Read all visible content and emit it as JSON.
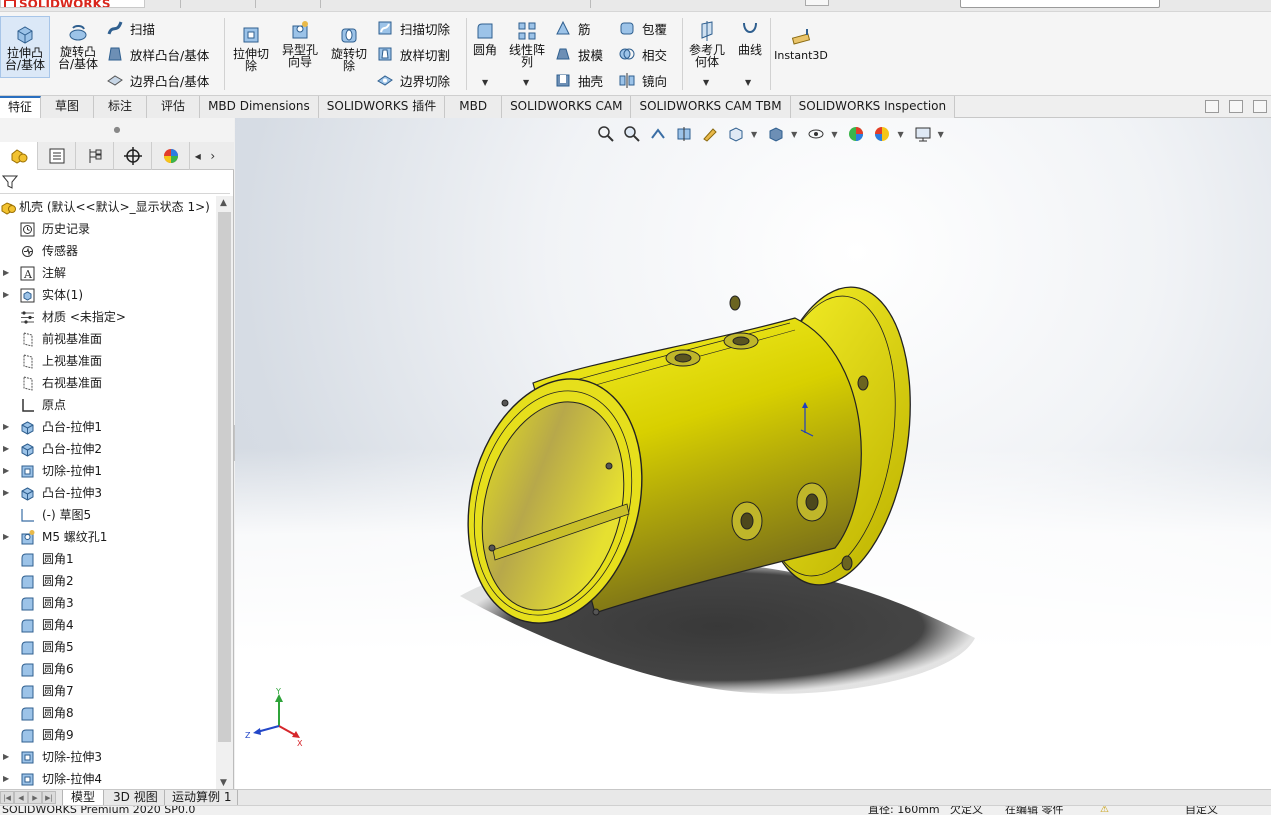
{
  "app": {
    "logo_text": "SOLIDWORKS"
  },
  "ribbon": {
    "extrude_boss": "拉伸凸\n台/基体",
    "revolve_boss": "旋转凸\n台/基体",
    "sweep": "扫描",
    "loft_boss": "放样凸台/基体",
    "boundary_boss": "边界凸台/基体",
    "extrude_cut": "拉伸切\n除",
    "hole_wizard": "异型孔\n向导",
    "revolve_cut": "旋转切\n除",
    "sweep_cut": "扫描切除",
    "loft_cut": "放样切割",
    "boundary_cut": "边界切除",
    "fillet": "圆角",
    "linear_pattern": "线性阵\n列",
    "rib": "筋",
    "draft": "拔模",
    "shell": "抽壳",
    "wrap": "包覆",
    "intersect": "相交",
    "mirror": "镜向",
    "ref_geometry": "参考几\n何体",
    "curves": "曲线",
    "instant3d": "Instant3D"
  },
  "command_tabs": [
    "特征",
    "草图",
    "标注",
    "评估",
    "MBD Dimensions",
    "SOLIDWORKS 插件",
    "MBD",
    "SOLIDWORKS CAM",
    "SOLIDWORKS CAM TBM",
    "SOLIDWORKS Inspection"
  ],
  "tree": {
    "root": "机壳  (默认<<默认>_显示状态 1>)",
    "items": [
      {
        "label": "历史记录",
        "icon": "history-icon",
        "expand": false
      },
      {
        "label": "传感器",
        "icon": "sensor-icon",
        "expand": false
      },
      {
        "label": "注解",
        "icon": "annotation-icon",
        "expand": true
      },
      {
        "label": "实体(1)",
        "icon": "solid-body-icon",
        "expand": true
      },
      {
        "label": "材质 <未指定>",
        "icon": "material-icon",
        "expand": false
      },
      {
        "label": "前视基准面",
        "icon": "plane-icon",
        "expand": false
      },
      {
        "label": "上视基准面",
        "icon": "plane-icon",
        "expand": false
      },
      {
        "label": "右视基准面",
        "icon": "plane-icon",
        "expand": false
      },
      {
        "label": "原点",
        "icon": "origin-icon",
        "expand": false
      },
      {
        "label": "凸台-拉伸1",
        "icon": "boss-extrude-icon",
        "expand": true
      },
      {
        "label": "凸台-拉伸2",
        "icon": "boss-extrude-icon",
        "expand": true
      },
      {
        "label": "切除-拉伸1",
        "icon": "cut-extrude-icon",
        "expand": true
      },
      {
        "label": "凸台-拉伸3",
        "icon": "boss-extrude-icon",
        "expand": true
      },
      {
        "label": "(-) 草图5",
        "icon": "sketch-icon",
        "expand": false
      },
      {
        "label": "M5 螺纹孔1",
        "icon": "hole-icon",
        "expand": true
      },
      {
        "label": "圆角1",
        "icon": "fillet-icon",
        "expand": false
      },
      {
        "label": "圆角2",
        "icon": "fillet-icon",
        "expand": false
      },
      {
        "label": "圆角3",
        "icon": "fillet-icon",
        "expand": false
      },
      {
        "label": "圆角4",
        "icon": "fillet-icon",
        "expand": false
      },
      {
        "label": "圆角5",
        "icon": "fillet-icon",
        "expand": false
      },
      {
        "label": "圆角6",
        "icon": "fillet-icon",
        "expand": false
      },
      {
        "label": "圆角7",
        "icon": "fillet-icon",
        "expand": false
      },
      {
        "label": "圆角8",
        "icon": "fillet-icon",
        "expand": false
      },
      {
        "label": "圆角9",
        "icon": "fillet-icon",
        "expand": false
      },
      {
        "label": "切除-拉伸3",
        "icon": "cut-extrude-icon",
        "expand": true
      },
      {
        "label": "切除-拉伸4",
        "icon": "cut-extrude-icon",
        "expand": true
      }
    ]
  },
  "bottom_tabs": [
    "模型",
    "3D 视图",
    "运动算例 1"
  ],
  "status": {
    "left": "SOLIDWORKS Premium 2020 SP0.0",
    "radius": "直径: 160mm",
    "defined": "欠定义",
    "editing": "在编辑 零件",
    "custom": "自定义"
  },
  "colors": {
    "part_yellow": "#e8e000",
    "accent_blue": "#2a6fbf"
  }
}
